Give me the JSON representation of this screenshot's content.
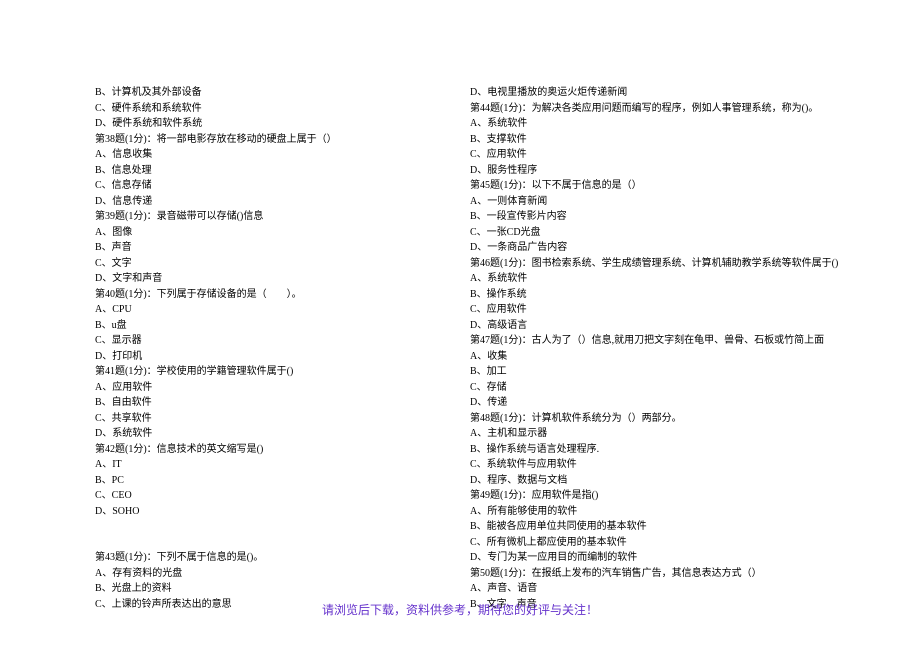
{
  "columns": [
    [
      {
        "text": "B、计算机及其外部设备"
      },
      {
        "text": "C、硬件系统和系统软件"
      },
      {
        "text": "D、硬件系统和软件系统"
      },
      {
        "text": "第38题(1分)：将一部电影存放在移动的硬盘上属于（）"
      },
      {
        "text": "A、信息收集"
      },
      {
        "text": "B、信息处理"
      },
      {
        "text": "C、信息存储"
      },
      {
        "text": "D、信息传递"
      },
      {
        "text": "第39题(1分)：录音磁带可以存储()信息"
      },
      {
        "text": "A、图像"
      },
      {
        "text": "B、声音"
      },
      {
        "text": "C、文字"
      },
      {
        "text": "D、文字和声音"
      },
      {
        "text": "第40题(1分)：下列属于存储设备的是（　　）。"
      },
      {
        "text": "A、CPU"
      },
      {
        "text": "B、u盘"
      },
      {
        "text": "C、显示器"
      },
      {
        "text": "D、打印机"
      },
      {
        "text": "第41题(1分)：学校使用的学籍管理软件属于()"
      },
      {
        "text": "A、应用软件"
      },
      {
        "text": "B、自由软件"
      },
      {
        "text": "C、共享软件"
      },
      {
        "text": "D、系统软件"
      },
      {
        "text": "第42题(1分)：信息技术的英文缩写是()"
      },
      {
        "text": "A、IT"
      },
      {
        "text": "B、PC"
      },
      {
        "text": "C、CEO"
      },
      {
        "text": "D、SOHO"
      },
      {
        "blank": true
      },
      {
        "blank": true
      },
      {
        "text": "第43题(1分)：下列不属于信息的是()。"
      },
      {
        "text": "A、存有资料的光盘"
      },
      {
        "text": "B、光盘上的资料"
      },
      {
        "text": "C、上课的铃声所表达出的意思"
      }
    ],
    [
      {
        "text": "D、电视里播放的奥运火炬传递新闻"
      },
      {
        "text": "第44题(1分)：为解决各类应用问题而编写的程序，例如人事管理系统，称为()。"
      },
      {
        "text": "A、系统软件"
      },
      {
        "text": "B、支撑软件"
      },
      {
        "text": "C、应用软件"
      },
      {
        "text": "D、服务性程序"
      },
      {
        "text": "第45题(1分)：以下不属于信息的是（）"
      },
      {
        "text": "A、一则体育新闻"
      },
      {
        "text": "B、一段宣传影片内容"
      },
      {
        "text": "C、一张CD光盘"
      },
      {
        "text": "D、一条商品广告内容"
      },
      {
        "text": "第46题(1分)：图书检索系统、学生成绩管理系统、计算机辅助教学系统等软件属于()"
      },
      {
        "text": "A、系统软件"
      },
      {
        "text": "B、操作系统"
      },
      {
        "text": "C、应用软件"
      },
      {
        "text": "D、高级语言"
      },
      {
        "text": "第47题(1分)：古人为了（）信息,就用刀把文字刻在龟甲、兽骨、石板或竹简上面"
      },
      {
        "text": "A、收集"
      },
      {
        "text": "B、加工"
      },
      {
        "text": "C、存储"
      },
      {
        "text": "D、传递"
      },
      {
        "text": "第48题(1分)：计算机软件系统分为（）两部分。"
      },
      {
        "text": "A、主机和显示器"
      },
      {
        "text": "B、操作系统与语言处理程序."
      },
      {
        "text": "C、系统软件与应用软件"
      },
      {
        "text": "D、程序、数据与文档"
      },
      {
        "text": "第49题(1分)：应用软件是指()"
      },
      {
        "text": "A、所有能够使用的软件"
      },
      {
        "text": "B、能被各应用单位共同使用的基本软件"
      },
      {
        "text": "C、所有微机上都应使用的基本软件"
      },
      {
        "text": "D、专门为某一应用目的而编制的软件"
      },
      {
        "text": "第50题(1分)：在报纸上发布的汽车销售广告，其信息表达方式（）"
      },
      {
        "text": "A、声音、语音"
      },
      {
        "text": "B、文字、声音"
      }
    ]
  ],
  "footer": "请浏览后下载，资料供参考，期待您的好评与关注！"
}
